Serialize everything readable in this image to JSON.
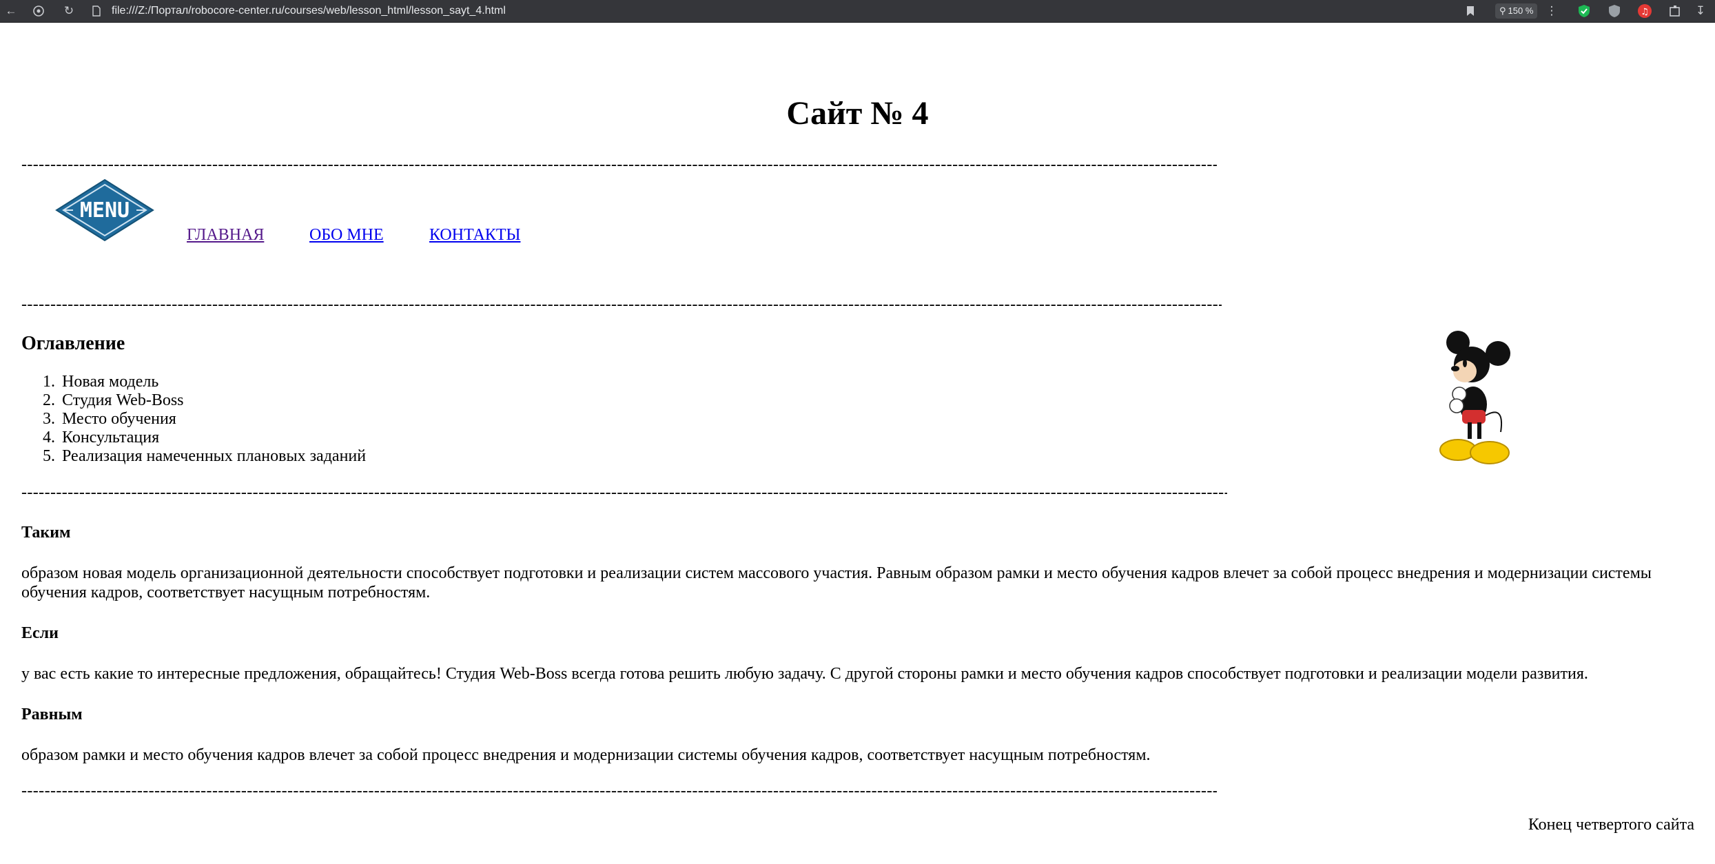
{
  "browser": {
    "address": "file:///Z:/Портал/robocore-center.ru/courses/web/lesson_html/lesson_sayt_4.html",
    "zoom": "150 %"
  },
  "page": {
    "title": "Сайт № 4",
    "separator": "--------------------------------------------------------------------------------------------------------------------------------------------------------------------------------------------------------------------------------------------------------------------------------------------------------------------",
    "nav": {
      "logo_text": "MENU",
      "links": [
        "ГЛАВНАЯ",
        "ОБО МНЕ",
        "КОНТАКТЫ"
      ]
    },
    "toc": {
      "heading": "Оглавление",
      "items": [
        "Новая модель",
        "Студия Web-Boss",
        "Место обучения",
        "Консультация",
        "Реализация намеченных плановых заданий"
      ]
    },
    "sections": [
      {
        "heading": "Таким",
        "text": "образом новая модель организационной деятельности способствует подготовки и реализации систем массового участия. Равным образом рамки и место обучения кадров влечет за собой процесс внедрения и модернизации системы обучения кадров, соответствует насущным потребностям."
      },
      {
        "heading": "Если",
        "text": "у вас есть какие то интересные предложения, обращайтесь! Студия Web-Boss всегда готова решить любую задачу. С другой стороны рамки и место обучения кадров способствует подготовки и реализации модели развития."
      },
      {
        "heading": "Равным",
        "text": "образом рамки и место обучения кадров влечет за собой процесс внедрения и модернизации системы обучения кадров, соответствует насущным потребностям."
      }
    ],
    "footer": "Конец четвертого сайта"
  },
  "colors": {
    "chrome_bg": "#35363a",
    "link": "#0000ee",
    "link_visited": "#551a8b",
    "logo_blue": "#1f6b9c"
  }
}
